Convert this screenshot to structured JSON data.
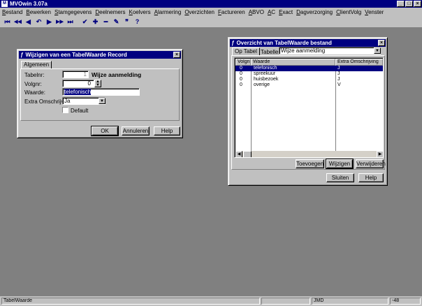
{
  "app": {
    "title": "MVOwin 3.07a",
    "icon": "mvo-app-icon"
  },
  "window_buttons": {
    "minimize": "_",
    "maximize": "□",
    "close": "×"
  },
  "menu": [
    "Bestand",
    "Bewerken",
    "Stamgegevens",
    "Deelnemers",
    "Koelvers",
    "Alarmering",
    "Overzichten",
    "Factureren",
    "ABVO",
    "AC",
    "Exact",
    "Dagverzorging",
    "ClientVolg",
    "Venster"
  ],
  "toolbar": [
    {
      "name": "first-record-icon",
      "glyph": "⏮"
    },
    {
      "name": "prev-page-icon",
      "glyph": "◀◀"
    },
    {
      "name": "prev-record-icon",
      "glyph": "◀"
    },
    {
      "name": "undo-icon",
      "glyph": "↶"
    },
    {
      "name": "next-record-icon",
      "glyph": "▶"
    },
    {
      "name": "next-page-icon",
      "glyph": "▶▶"
    },
    {
      "name": "last-record-icon",
      "glyph": "⏭"
    },
    {
      "name": "confirm-icon",
      "glyph": "✔"
    },
    {
      "name": "add-icon",
      "glyph": "✚"
    },
    {
      "name": "delete-icon",
      "glyph": "▬"
    },
    {
      "name": "edit-icon",
      "glyph": "✎"
    },
    {
      "name": "quote-icon",
      "glyph": "❞"
    },
    {
      "name": "help-icon",
      "glyph": "?"
    }
  ],
  "edit_dialog": {
    "title": "Wijzigen van een TabelWaarde Record",
    "tab": "Algemeen",
    "tablenr_label": "Tabelnr:",
    "tablenr_value": "1",
    "tablenr_name": "Wijze aanmelding",
    "volgnr_label": "Volgnr:",
    "volgnr_value": "0",
    "waarde_label": "Waarde:",
    "waarde_value": "telefonisch",
    "extra_label": "Extra Omschrijving:",
    "extra_value": "Ja",
    "default_label": "Default",
    "ok": "OK",
    "cancel": "Annuleren",
    "help": "Help"
  },
  "overview_dialog": {
    "title": "Overzicht van TabelWaarde bestand",
    "tab": "Op Tabel",
    "tabellen_label": "Tabellen:",
    "tabellen_value": "Wijze aanmelding",
    "columns": [
      "Volgnr",
      "Waarde",
      "Extra Omschrijving"
    ],
    "rows": [
      [
        "0",
        "telefonisch",
        "J"
      ],
      [
        "0",
        "spreekuur",
        "J"
      ],
      [
        "0",
        "huisbezoek",
        "J"
      ],
      [
        "0",
        "overige",
        "V"
      ]
    ],
    "add": "Toevoegen",
    "edit": "Wijzigen",
    "delete": "Verwijderen",
    "close": "Sluiten",
    "help": "Help"
  },
  "status": {
    "left": "TabelWaarde",
    "user": "JMD",
    "right": "-48"
  }
}
